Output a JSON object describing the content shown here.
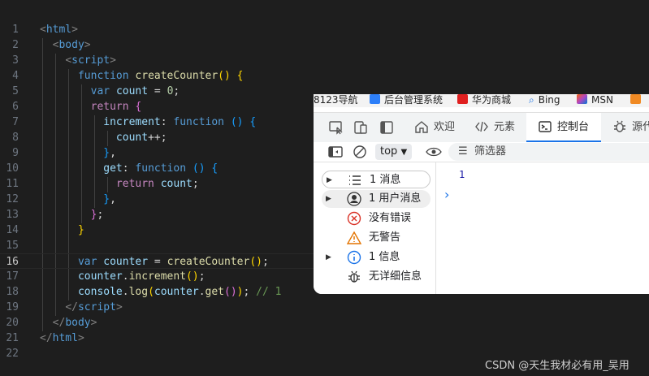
{
  "editor": {
    "line_numbers": [
      "1",
      "2",
      "3",
      "4",
      "5",
      "6",
      "7",
      "8",
      "9",
      "10",
      "11",
      "12",
      "13",
      "14",
      "15",
      "16",
      "17",
      "18",
      "19",
      "20",
      "21",
      "22"
    ],
    "tokens": {
      "html": "html",
      "body": "body",
      "script": "script",
      "function": "function",
      "create_counter": "createCounter",
      "var": "var",
      "count": "count",
      "zero": "0",
      "return": "return",
      "increment": "increment",
      "get": "get",
      "counter": "counter",
      "console": "console",
      "log": "log",
      "comment": "// 1"
    }
  },
  "browser": {
    "bookmarks": [
      "8123导航",
      "后台管理系统",
      "华为商城",
      "Bing",
      "MSN"
    ],
    "devtools_tabs": {
      "welcome": "欢迎",
      "elements": "元素",
      "console": "控制台",
      "sources": "源代"
    },
    "toolbar": {
      "context": "top",
      "filter_label": "筛选器"
    },
    "sidebar": [
      {
        "label": "1 消息"
      },
      {
        "label": "1 用户消息"
      },
      {
        "label": "没有错误"
      },
      {
        "label": "无警告"
      },
      {
        "label": "1 信息"
      },
      {
        "label": "无详细信息"
      }
    ],
    "console_output": "1",
    "prompt_symbol": "›"
  },
  "watermark": "CSDN @天生我材必有用_吴用",
  "colors": {
    "editor_bg": "#1e1e1e",
    "keyword": "#569cd6",
    "function_name": "#dcdcaa",
    "variable": "#9cdcfe",
    "number": "#b5cea8",
    "comment": "#6a9955",
    "accent": "#1a73e8"
  }
}
